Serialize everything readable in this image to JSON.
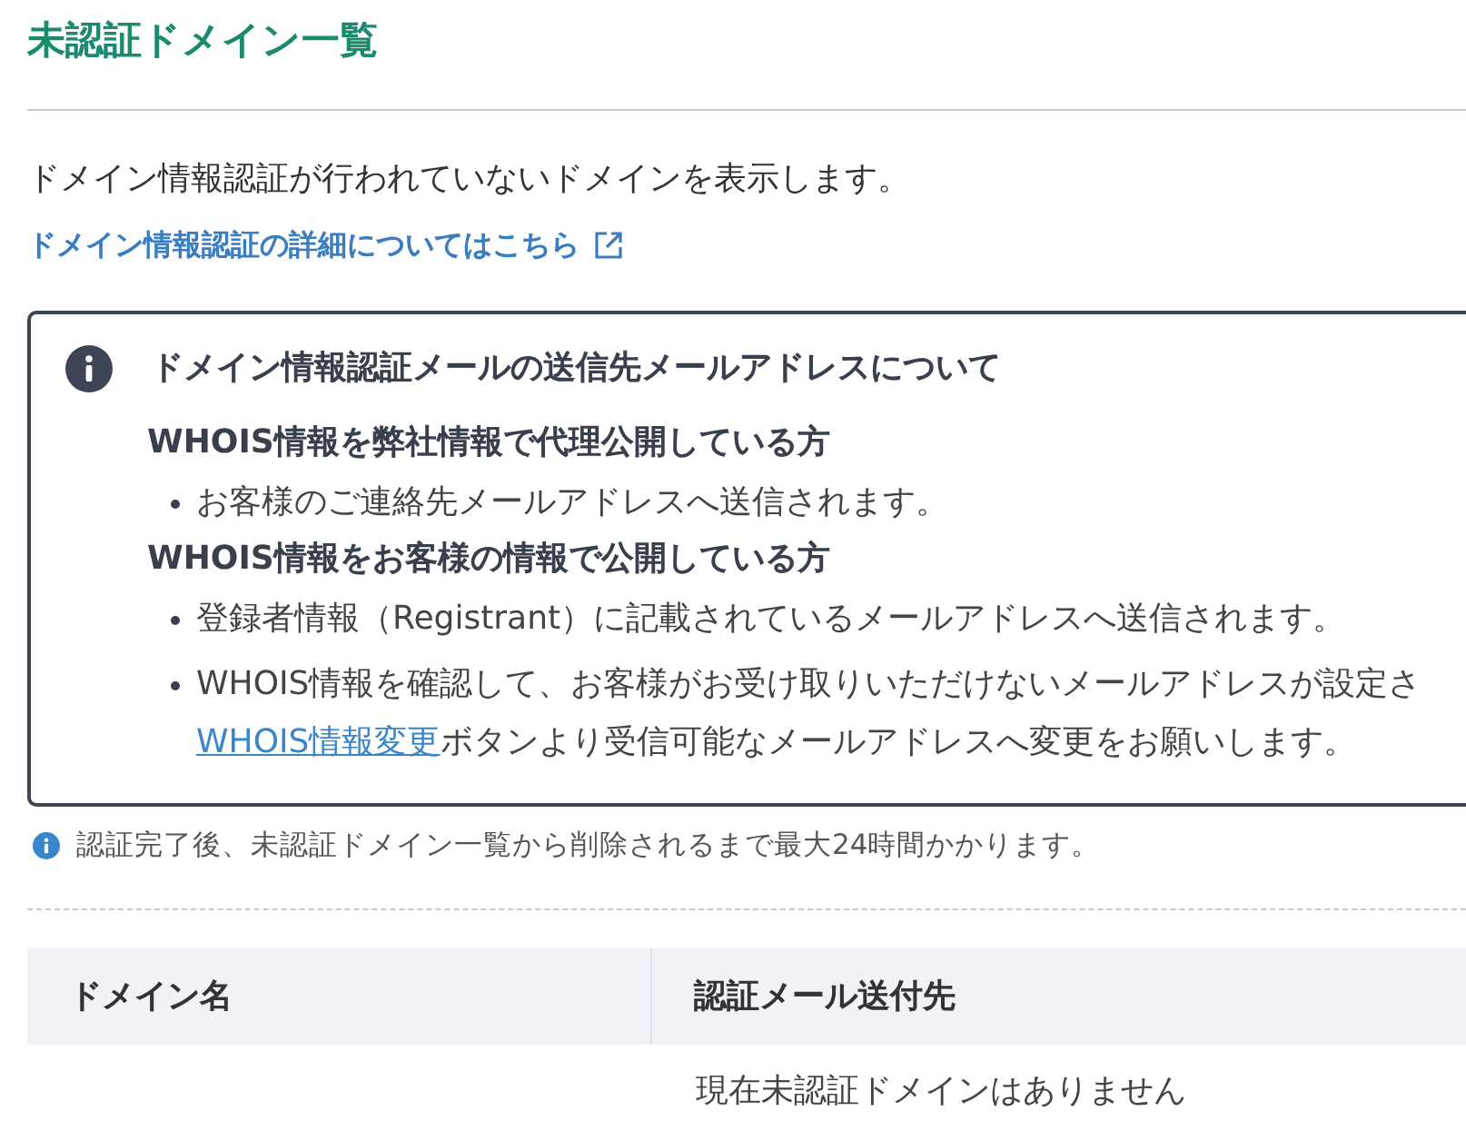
{
  "page_title": "未認証ドメイン一覧",
  "description": "ドメイン情報認証が行われていないドメインを表示します。",
  "detail_link": {
    "label": "ドメイン情報認証の詳細についてはこちら"
  },
  "notice_box": {
    "heading": "ドメイン情報認証メールの送信先メールアドレスについて",
    "sections": [
      {
        "heading": "WHOIS情報を弊社情報で代理公開している方",
        "bullets": [
          {
            "kind": "text",
            "text": "お客様のご連絡先メールアドレスへ送信されます。"
          }
        ]
      },
      {
        "heading": "WHOIS情報をお客様の情報で公開している方",
        "bullets": [
          {
            "kind": "text",
            "text": "登録者情報（Registrant）に記載されているメールアドレスへ送信されます。"
          },
          {
            "kind": "link_text",
            "text": "WHOIS情報を確認して、お客様がお受け取りいただけないメールアドレスが設定さ",
            "link": "WHOIS情報変更",
            "text_after": "ボタンより受信可能なメールアドレスへ変更をお願いします。"
          }
        ]
      }
    ]
  },
  "note": "認証完了後、未認証ドメイン一覧から削除されるまで最大24時間かかります。",
  "table": {
    "columns": [
      "ドメイン名",
      "認証メール送付先"
    ],
    "empty_message": "現在未認証ドメインはありません"
  }
}
